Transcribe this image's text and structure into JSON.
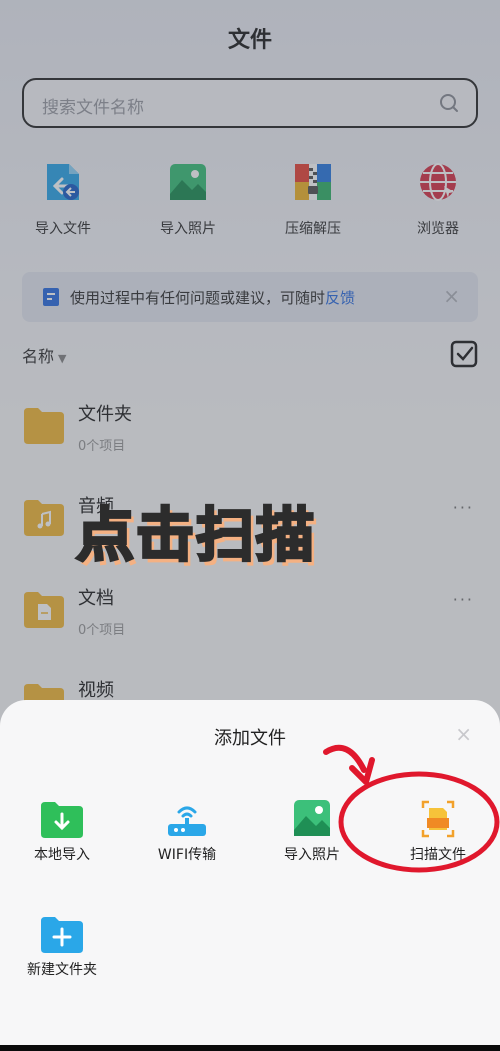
{
  "header": {
    "title": "文件"
  },
  "search": {
    "placeholder": "搜索文件名称"
  },
  "quick_actions": [
    {
      "label": "导入文件",
      "icon": "import-file-icon"
    },
    {
      "label": "导入照片",
      "icon": "import-photo-icon"
    },
    {
      "label": "压缩解压",
      "icon": "zip-icon"
    },
    {
      "label": "浏览器",
      "icon": "browser-icon"
    }
  ],
  "notice": {
    "text": "使用过程中有任何问题或建议，可随时",
    "link": "反馈",
    "close": "×"
  },
  "sort": {
    "label": "名称"
  },
  "files": [
    {
      "name": "文件夹",
      "count": "0个项目",
      "more": ""
    },
    {
      "name": "音频",
      "count": "",
      "more": "···"
    },
    {
      "name": "文档",
      "count": "0个项目",
      "more": "···"
    },
    {
      "name": "视频",
      "count": "",
      "more": ""
    }
  ],
  "overlay_banner": "点击扫描",
  "sheet": {
    "title": "添加文件",
    "close": "×",
    "actions": [
      {
        "label": "本地导入",
        "icon": "local-import-icon"
      },
      {
        "label": "WIFI传输",
        "icon": "wifi-transfer-icon"
      },
      {
        "label": "导入照片",
        "icon": "import-photo-icon"
      },
      {
        "label": "扫描文件",
        "icon": "scan-file-icon"
      },
      {
        "label": "新建文件夹",
        "icon": "new-folder-icon"
      }
    ]
  },
  "colors": {
    "accent": "#2f6fe0",
    "folder": "#f2b93b",
    "annotation_red": "#e0182d",
    "banner_shadow": "#f4b183"
  }
}
